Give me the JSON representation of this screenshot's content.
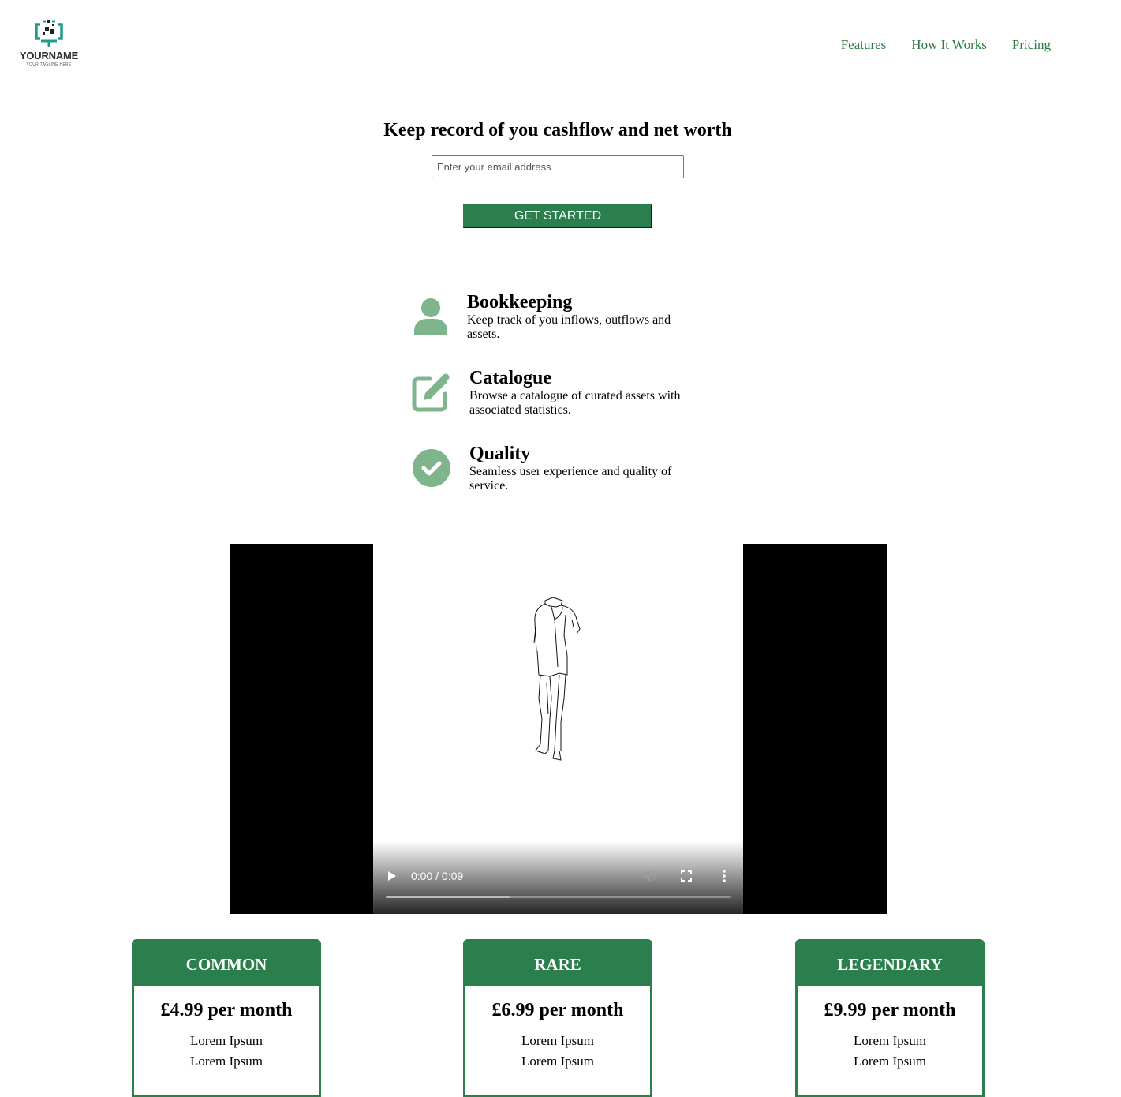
{
  "header": {
    "logo": {
      "name": "YOURNAME",
      "tagline": "YOUR TAGLINE HERE"
    },
    "nav": [
      {
        "label": "Features"
      },
      {
        "label": "How It Works"
      },
      {
        "label": "Pricing"
      }
    ]
  },
  "hero": {
    "title": "Keep record of you cashflow and net worth",
    "email_placeholder": "Enter your email address",
    "email_value": "",
    "cta_label": "GET STARTED"
  },
  "features": [
    {
      "icon": "user-icon",
      "title": "Bookkeeping",
      "description": "Keep track of you inflows, outflows and assets."
    },
    {
      "icon": "edit-icon",
      "title": "Catalogue",
      "description": "Browse a catalogue of curated assets with associated statistics."
    },
    {
      "icon": "check-circle-icon",
      "title": "Quality",
      "description": "Seamless user experience and quality of service."
    }
  ],
  "video": {
    "time": "0:00 / 0:09",
    "buffered_fraction": 0.36
  },
  "pricing": [
    {
      "name": "COMMON",
      "price": "£4.99 per month",
      "items": [
        "Lorem Ipsum",
        "Lorem Ipsum"
      ]
    },
    {
      "name": "RARE",
      "price": "£6.99 per month",
      "items": [
        "Lorem Ipsum",
        "Lorem Ipsum"
      ]
    },
    {
      "name": "LEGENDARY",
      "price": "£9.99 per month",
      "items": [
        "Lorem Ipsum",
        "Lorem Ipsum"
      ]
    }
  ],
  "colors": {
    "accent": "#2a7f4c",
    "nav_link": "#2a7a44",
    "icon_green": "#7fb58d",
    "logo_teal": "#1f9c8c"
  }
}
